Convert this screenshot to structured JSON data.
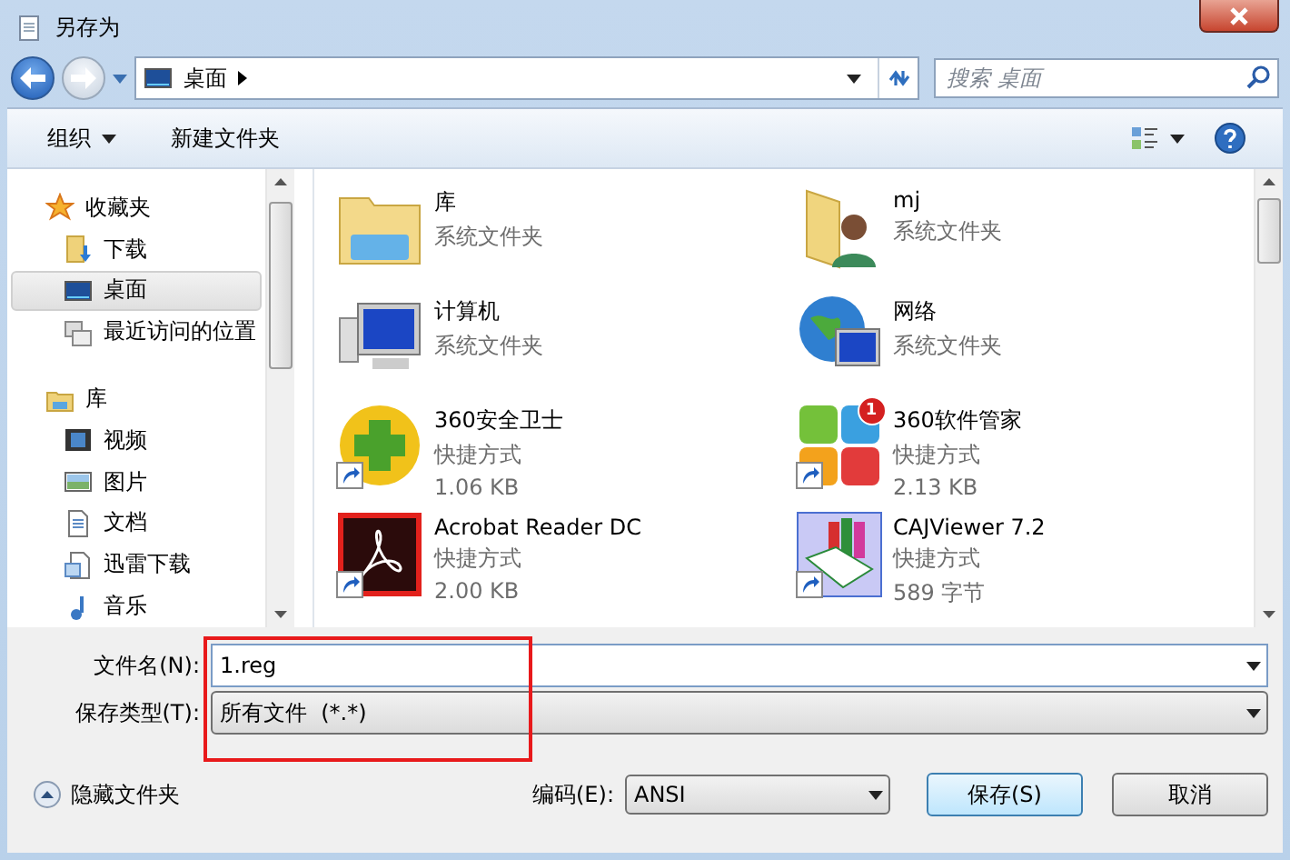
{
  "window": {
    "title": "另存为"
  },
  "address": {
    "path": "桌面",
    "search_placeholder": "搜索 桌面"
  },
  "toolbar": {
    "organize": "组织",
    "new_folder": "新建文件夹"
  },
  "sidebar": {
    "groups": [
      {
        "label": "收藏夹",
        "kind": "star",
        "children": [
          {
            "label": "下载",
            "kind": "download",
            "selected": false
          },
          {
            "label": "桌面",
            "kind": "desktop",
            "selected": true
          },
          {
            "label": "最近访问的位置",
            "kind": "recent",
            "selected": false
          }
        ]
      },
      {
        "label": "库",
        "kind": "library",
        "children": [
          {
            "label": "视频",
            "kind": "video",
            "selected": false
          },
          {
            "label": "图片",
            "kind": "picture",
            "selected": false
          },
          {
            "label": "文档",
            "kind": "document",
            "selected": false
          },
          {
            "label": "迅雷下载",
            "kind": "thunder",
            "selected": false
          },
          {
            "label": "音乐",
            "kind": "music",
            "selected": false
          }
        ]
      }
    ]
  },
  "files": [
    {
      "name": "库",
      "type": "系统文件夹",
      "kind": "library",
      "shortcut": false
    },
    {
      "name": "mj",
      "type": "系统文件夹",
      "kind": "user-folder",
      "shortcut": false
    },
    {
      "name": "计算机",
      "type": "系统文件夹",
      "kind": "computer",
      "shortcut": false
    },
    {
      "name": "网络",
      "type": "系统文件夹",
      "kind": "network",
      "shortcut": false
    },
    {
      "name": "360安全卫士",
      "type": "快捷方式",
      "size": "1.06 KB",
      "kind": "plus-app",
      "shortcut": true
    },
    {
      "name": "360软件管家",
      "type": "快捷方式",
      "size": "2.13 KB",
      "kind": "tiles-app",
      "shortcut": true,
      "badge": "1"
    },
    {
      "name": "Acrobat Reader DC",
      "type": "快捷方式",
      "size": "2.00 KB",
      "kind": "pdf-app",
      "shortcut": true
    },
    {
      "name": "CAJViewer 7.2",
      "type": "快捷方式",
      "size": "589 字节",
      "kind": "book-app",
      "shortcut": true
    }
  ],
  "form": {
    "filename_label": "文件名(N):",
    "filename": "1.reg",
    "type_label": "保存类型(T):",
    "type_value": "所有文件  (*.*)"
  },
  "footer": {
    "hide_folders": "隐藏文件夹",
    "encoding_label": "编码(E):",
    "encoding": "ANSI",
    "save": "保存(S)",
    "cancel": "取消"
  }
}
